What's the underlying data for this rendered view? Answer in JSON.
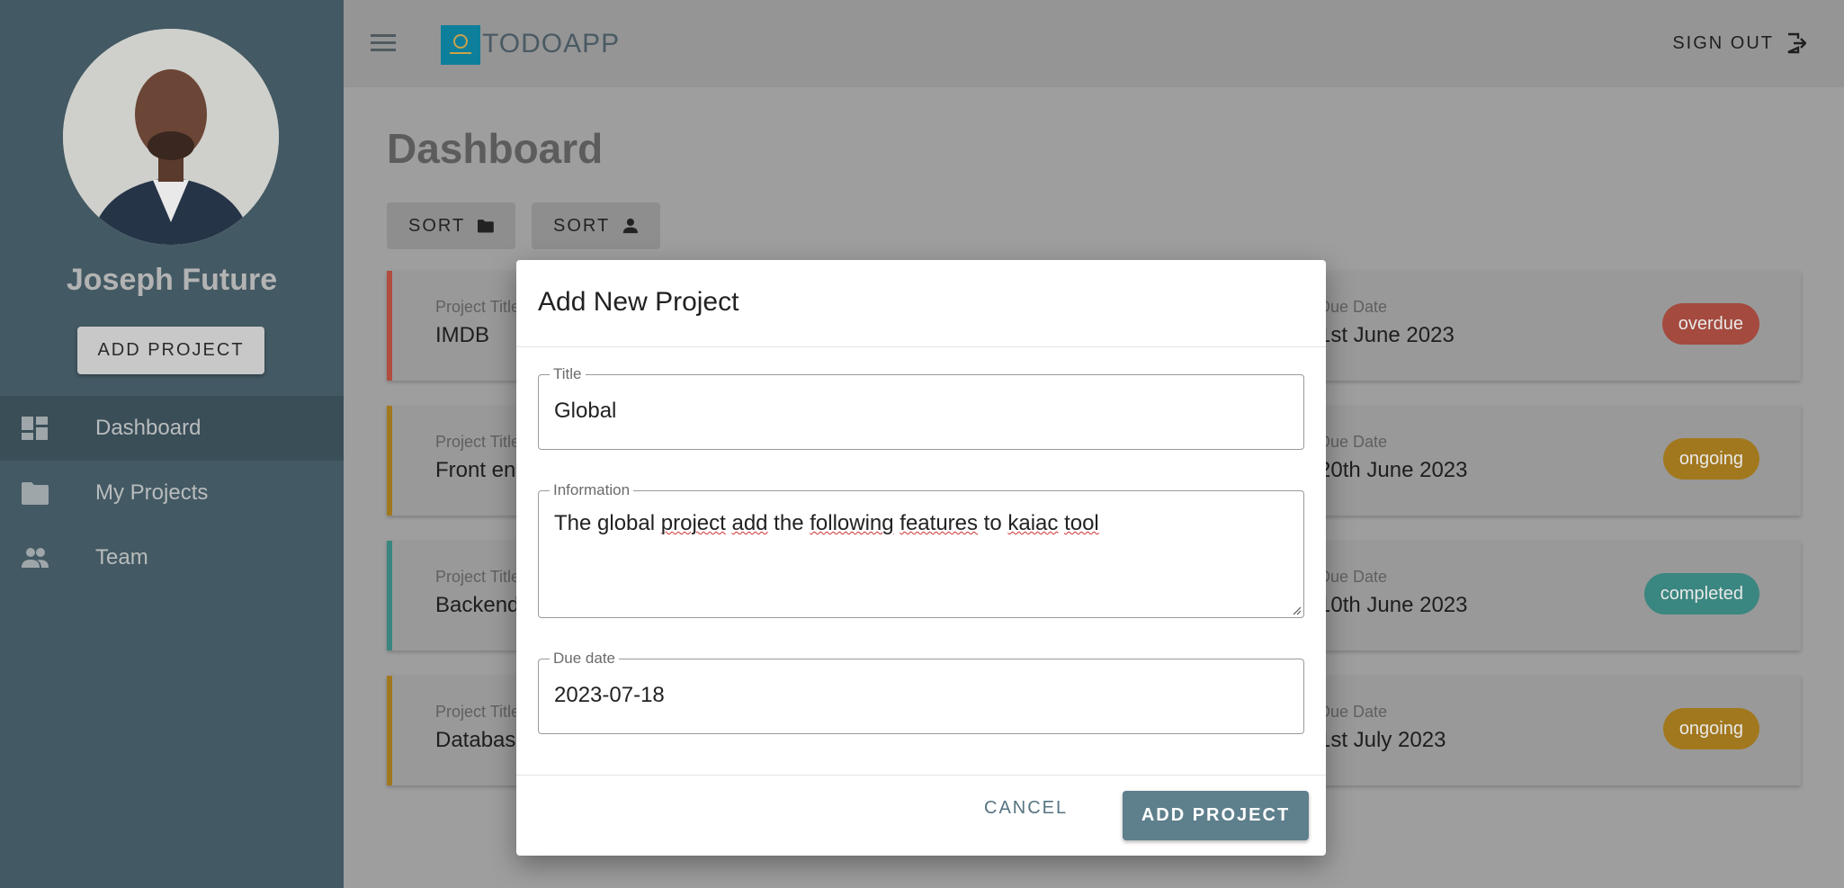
{
  "sidebar": {
    "user_name": "Joseph Future",
    "add_project_label": "ADD PROJECT",
    "items": [
      {
        "label": "Dashboard",
        "icon": "dashboard-icon"
      },
      {
        "label": "My Projects",
        "icon": "folder-icon"
      },
      {
        "label": "Team",
        "icon": "people-icon"
      }
    ]
  },
  "header": {
    "app_title": "TODOAPP",
    "sign_out_label": "SIGN OUT"
  },
  "main": {
    "page_title": "Dashboard",
    "sort_buttons": [
      {
        "label": "SORT",
        "icon": "folder-icon"
      },
      {
        "label": "SORT",
        "icon": "person-icon"
      }
    ],
    "projects": [
      {
        "title_label": "Project Title",
        "title": "IMDB",
        "due_label": "Due Date",
        "due": "1st June 2023",
        "status": "overdue",
        "status_color": "#a44a3e"
      },
      {
        "title_label": "Project Title",
        "title": "Front end",
        "due_label": "Due Date",
        "due": "20th June 2023",
        "status": "ongoing",
        "status_color": "#a2781e"
      },
      {
        "title_label": "Project Title",
        "title": "Backend",
        "due_label": "Due Date",
        "due": "10th June 2023",
        "status": "completed",
        "status_color": "#3a8680"
      },
      {
        "title_label": "Project Title",
        "title": "Database",
        "due_label": "Due Date",
        "due": "1st July 2023",
        "status": "ongoing",
        "status_color": "#a2781e"
      }
    ]
  },
  "dialog": {
    "title": "Add New Project",
    "fields": {
      "title_label": "Title",
      "title_value": "Global",
      "information_label": "Information",
      "information_words": [
        "The global ",
        "project",
        " ",
        "add",
        " the ",
        "following",
        " ",
        "features",
        " to ",
        "kaiac",
        " ",
        "tool"
      ],
      "due_label": "Due date",
      "due_value": "2023-07-18"
    },
    "cancel_label": "CANCEL",
    "add_label": "ADD PROJECT"
  },
  "colors": {
    "sidebar": "#435963",
    "primary_button": "#5e7f8c",
    "overdue": "#a44a3e",
    "ongoing": "#a2781e",
    "completed": "#3a8680"
  }
}
